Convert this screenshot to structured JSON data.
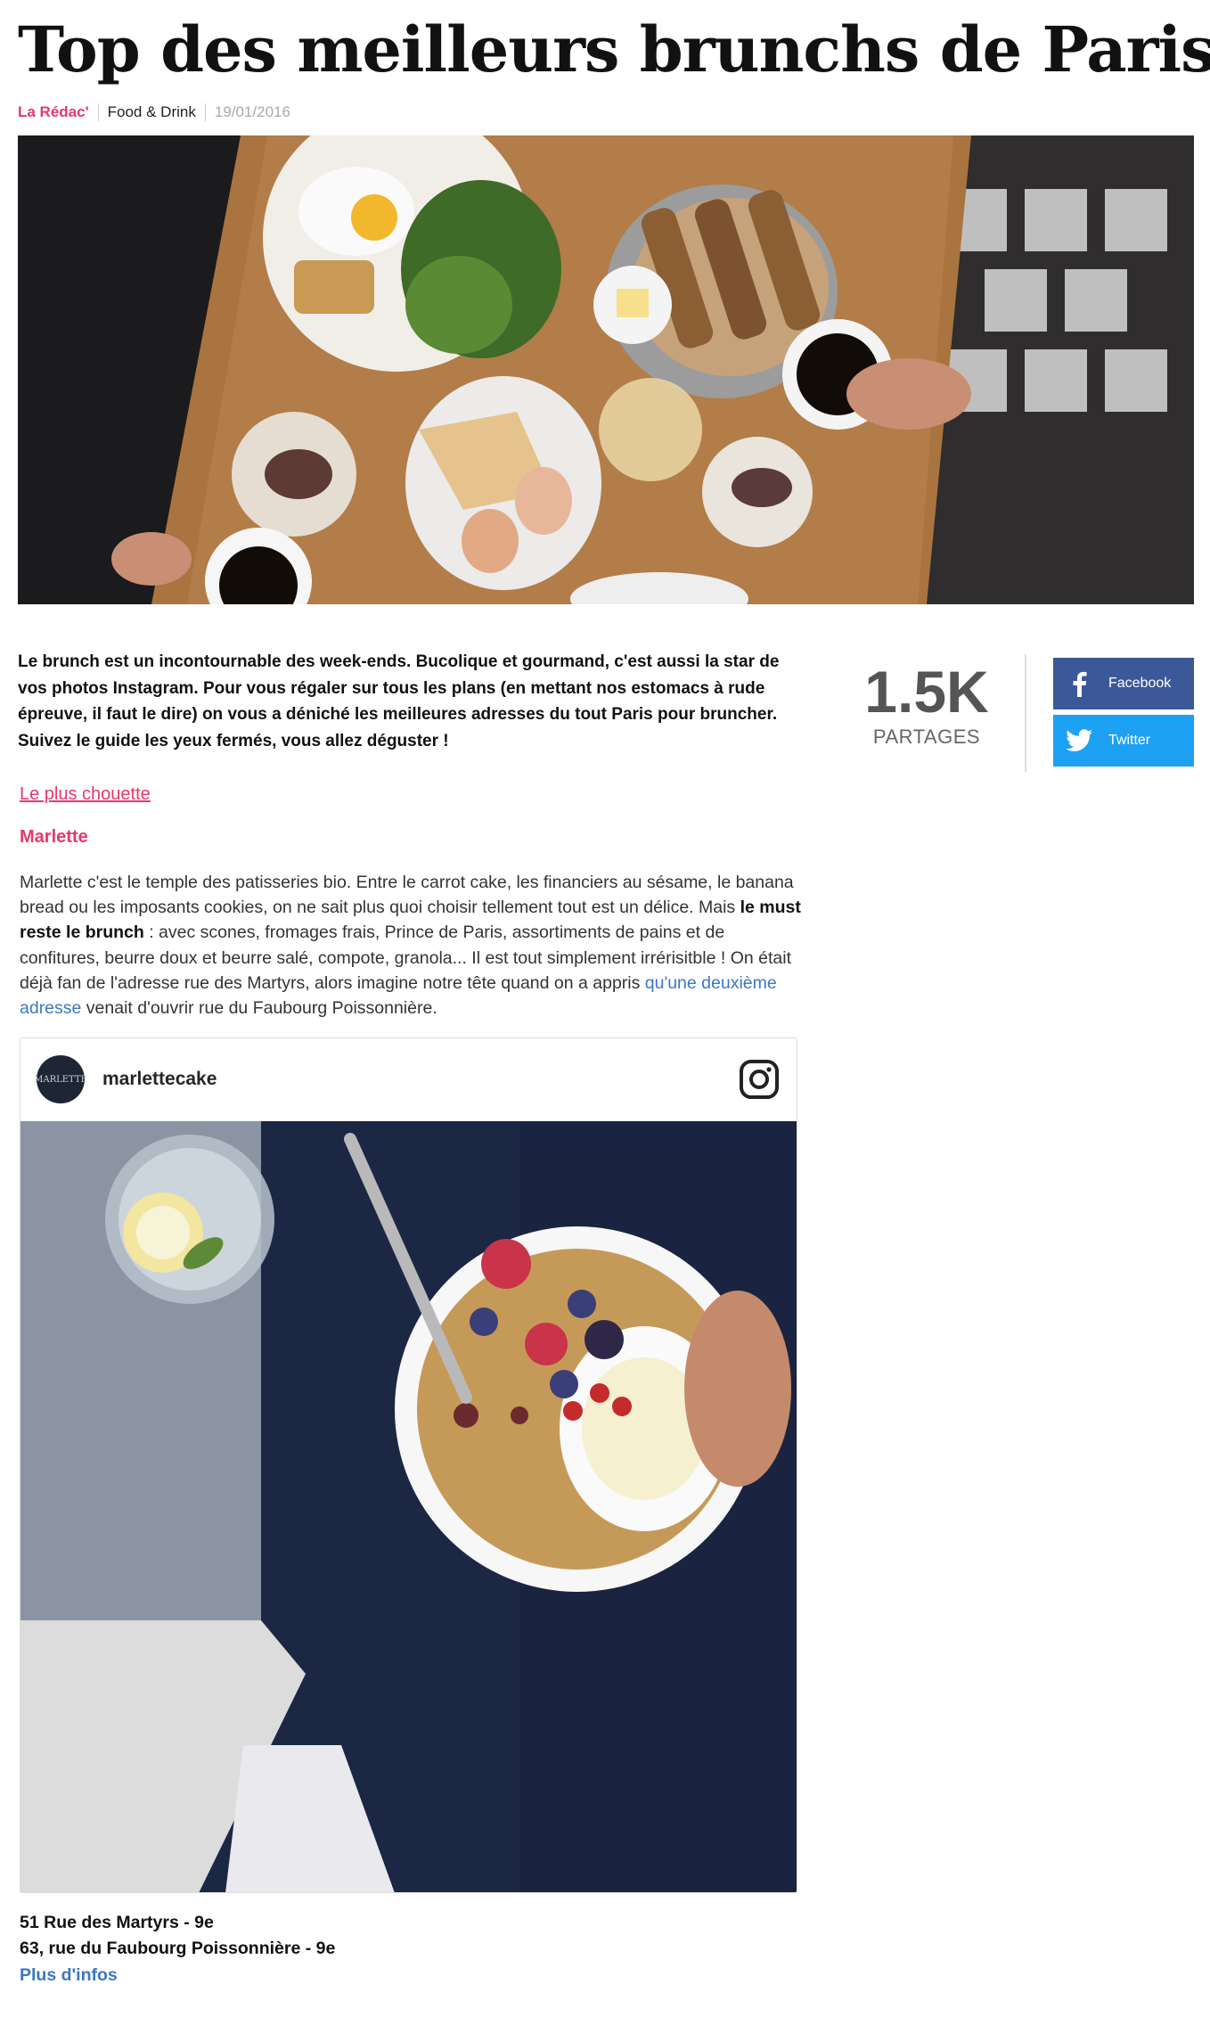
{
  "article": {
    "title": "Top des meilleurs brunchs de Paris",
    "author": "La Rédac'",
    "category": "Food & Drink",
    "date": "19/01/2016",
    "intro": "Le brunch est un incontournable des week-ends. Bucolique et gourmand, c'est aussi la star de vos photos Instagram. Pour vous régaler sur tous les plans (en mettant nos estomacs à rude épreuve, il faut le dire) on vous a déniché les meilleures adresses du tout Paris pour bruncher. Suivez le guide les yeux fermés, vous allez déguster !"
  },
  "share": {
    "count": "1.5K",
    "label": "PARTAGES",
    "facebook_label": "Facebook",
    "twitter_label": "Twitter",
    "facebook_color": "#3b5998",
    "twitter_color": "#1da1f2"
  },
  "section": {
    "link": "Le plus chouette",
    "title": "Marlette",
    "body_part1": "Marlette c'est le temple des patisseries bio. Entre le carrot cake, les financiers au sésame, le banana bread ou les imposants cookies, on ne sait plus quoi choisir tellement tout est un délice. Mais ",
    "body_bold": "le must reste le brunch",
    "body_part2": " : avec scones, fromages frais, Prince de Paris, assortiments de pains et de confitures, beurre doux et beurre salé, compote, granola... Il est tout simplement irrérisitble ! On était déjà fan de l'adresse rue des Martyrs, alors imagine notre tête quand on a appris ",
    "body_link": "qu'une deuxième adresse",
    "body_part3": " venait d'ouvrir rue du Faubourg Poissonnière."
  },
  "instagram": {
    "username": "marlettecake",
    "avatar_text": "MARLETTE",
    "logo_icon": "instagram-icon"
  },
  "addresses": [
    "51 Rue des Martyrs - 9e",
    "63, rue du Faubourg Poissonnière - 9e"
  ],
  "more_info": "Plus d'infos",
  "colors": {
    "accent": "#e5386b",
    "link": "#3b78c0"
  }
}
